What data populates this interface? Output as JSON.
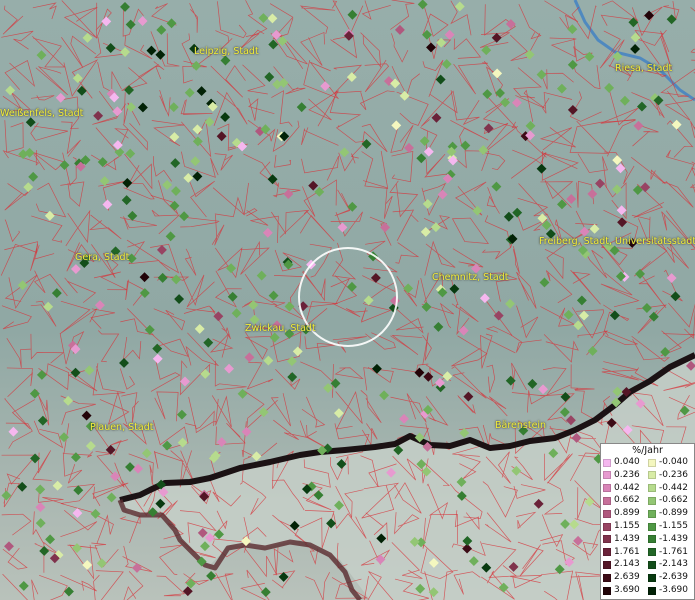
{
  "cities": [
    {
      "name": "Leipzig, Stadt"
    },
    {
      "name": "Riesa, Stadt"
    },
    {
      "name": "Weißenfels, Stadt"
    },
    {
      "name": "Gera, Stadt"
    },
    {
      "name": "Chemnitz, Stadt"
    },
    {
      "name": "Freiberg, Stadt, Universitätsstadt"
    },
    {
      "name": "Zwickau, Stadt"
    },
    {
      "name": "Plauen, Stadt"
    },
    {
      "name": "Bärenstein"
    }
  ],
  "legend": {
    "title": "%/Jahr",
    "positive": [
      {
        "label": "0.040",
        "color": "#f5b7ef"
      },
      {
        "label": "0.236",
        "color": "#e79ad0"
      },
      {
        "label": "0.442",
        "color": "#d985b8"
      },
      {
        "label": "0.662",
        "color": "#c7709a"
      },
      {
        "label": "0.899",
        "color": "#b0587e"
      },
      {
        "label": "1.155",
        "color": "#984463"
      },
      {
        "label": "1.439",
        "color": "#80334d"
      },
      {
        "label": "1.761",
        "color": "#6a2239"
      },
      {
        "label": "2.143",
        "color": "#541626"
      },
      {
        "label": "2.639",
        "color": "#3c0b16"
      },
      {
        "label": "3.690",
        "color": "#220308"
      }
    ],
    "negative": [
      {
        "label": "-0.040",
        "color": "#f4f7bf"
      },
      {
        "label": "-0.236",
        "color": "#d8eca6"
      },
      {
        "label": "-0.442",
        "color": "#b6db8d"
      },
      {
        "label": "-0.662",
        "color": "#93c674"
      },
      {
        "label": "-0.899",
        "color": "#6fb05b"
      },
      {
        "label": "-1.155",
        "color": "#4f9844"
      },
      {
        "label": "-1.439",
        "color": "#367f33"
      },
      {
        "label": "-1.761",
        "color": "#226626"
      },
      {
        "label": "-2.143",
        "color": "#134e1a"
      },
      {
        "label": "-2.639",
        "color": "#083a10"
      },
      {
        "label": "-3.690",
        "color": "#022206"
      }
    ]
  }
}
